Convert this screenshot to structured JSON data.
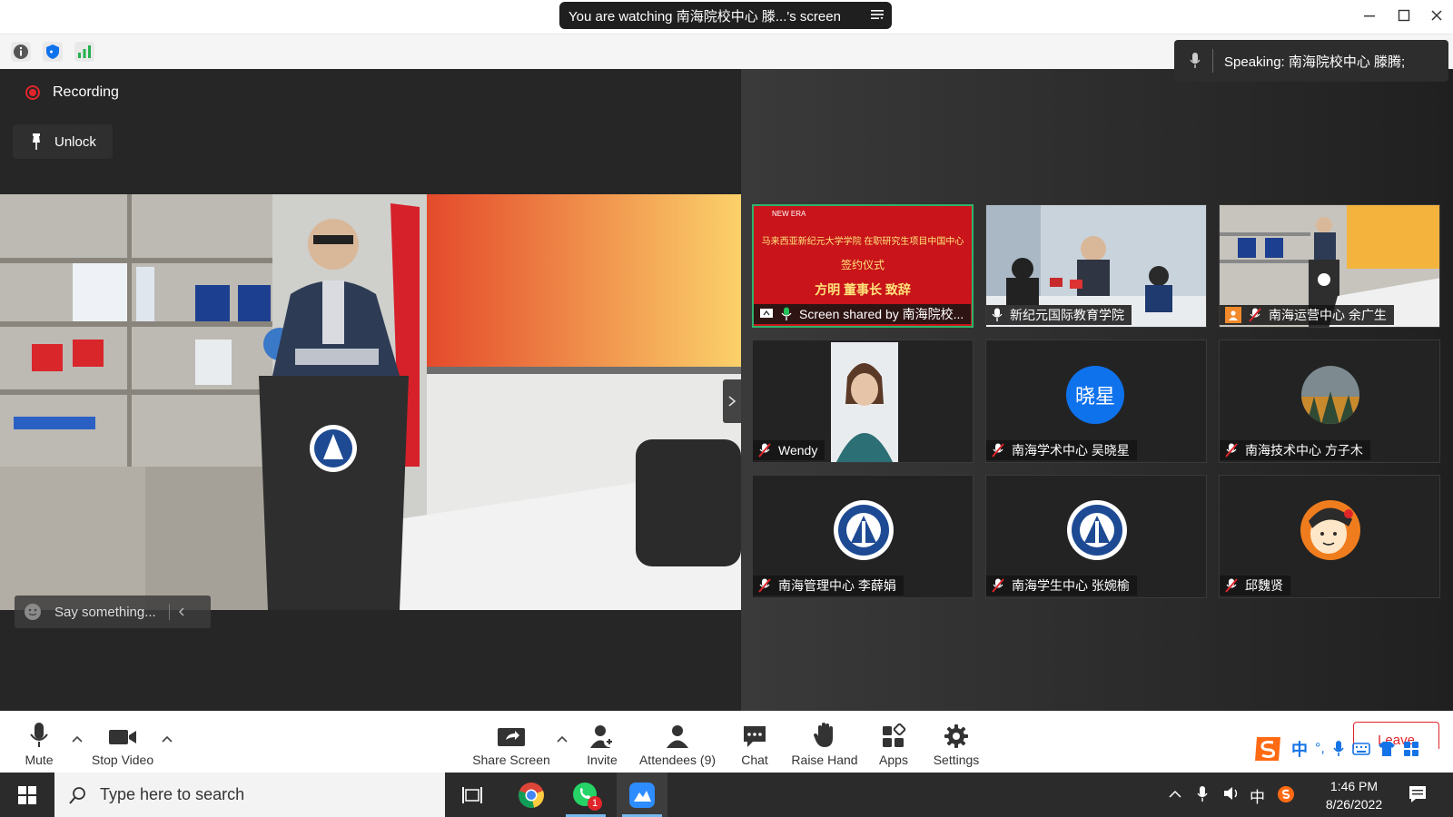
{
  "title_bar": {
    "watching_text": "You are watching 南海院校中心 滕...'s screen"
  },
  "speaking": {
    "text": "Speaking: 南海院校中心 滕腾;"
  },
  "recording": {
    "label": "Recording"
  },
  "unlock": {
    "label": "Unlock"
  },
  "chat_input": {
    "placeholder": "Say something..."
  },
  "gallery": [
    {
      "label": "Screen shared by 南海院校...",
      "slide": {
        "brand": "NEW ERA",
        "line1": "马来西亚新纪元大学学院 在职研究生项目中国中心",
        "line2": "签约仪式",
        "line3": "方明 董事长 致辞"
      }
    },
    {
      "label": "新纪元国际教育学院"
    },
    {
      "label": "南海运营中心 余广生"
    },
    {
      "label": "Wendy"
    },
    {
      "label": "南海学术中心 吴晓星",
      "avatar_text": "晓星"
    },
    {
      "label": "南海技术中心 方子木"
    },
    {
      "label": "南海管理中心 李薛娟"
    },
    {
      "label": "南海学生中心 张婉榆"
    },
    {
      "label": "邱魏贤"
    }
  ],
  "controls": {
    "mute": "Mute",
    "stop_video": "Stop Video",
    "share_screen": "Share Screen",
    "invite": "Invite",
    "attendees": "Attendees (9)",
    "chat": "Chat",
    "raise_hand": "Raise Hand",
    "apps": "Apps",
    "settings": "Settings",
    "leave": "Leave"
  },
  "ime": {
    "lang": "中",
    "punct": "°,"
  },
  "taskbar": {
    "search_placeholder": "Type here to search",
    "whatsapp_badge": "1",
    "tray_lang": "中",
    "time": "1:46 PM",
    "date": "8/26/2022"
  },
  "colors": {
    "accent_green": "#2fb36b",
    "record_red": "#e0252b",
    "avatar_blue": "#0e72ed",
    "slide_red": "#c8141a"
  }
}
